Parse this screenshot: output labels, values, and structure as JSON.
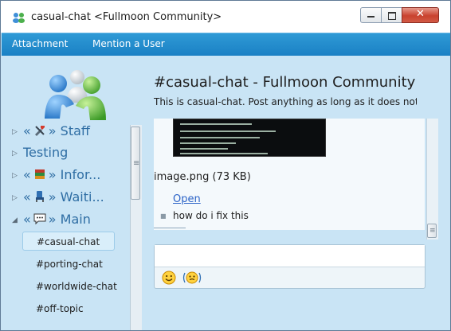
{
  "window": {
    "title": "casual-chat <Fullmoon Community>"
  },
  "menu": {
    "attachment": "Attachment",
    "mention": "Mention a User"
  },
  "sidebar": {
    "groups": [
      {
        "prefix": "«",
        "label": "» Staff",
        "icon": "tools-icon",
        "expanded": false
      },
      {
        "prefix": "",
        "label": "Testing",
        "icon": "",
        "expanded": false
      },
      {
        "prefix": "«",
        "label": "» Infor...",
        "icon": "books-icon",
        "expanded": false
      },
      {
        "prefix": "«",
        "label": "» Waiti...",
        "icon": "chair-icon",
        "expanded": false
      },
      {
        "prefix": "«",
        "label": "» Main",
        "icon": "speech-bubble-icon",
        "expanded": true
      }
    ],
    "channels": [
      "#casual-chat",
      "#porting-chat",
      "#worldwide-chat",
      "#off-topic"
    ],
    "selected_channel": "#casual-chat"
  },
  "channel": {
    "title": "#casual-chat - Fullmoon Community",
    "topic": "This is casual-chat. Post anything as long as it does not brea..."
  },
  "messages": {
    "attachment_name": "image.png (73 KB)",
    "open_link": "Open",
    "text": "how do i fix this"
  },
  "compose": {
    "input_value": "",
    "emoji_icons": [
      "smiley-icon",
      "nudge-icon"
    ]
  }
}
